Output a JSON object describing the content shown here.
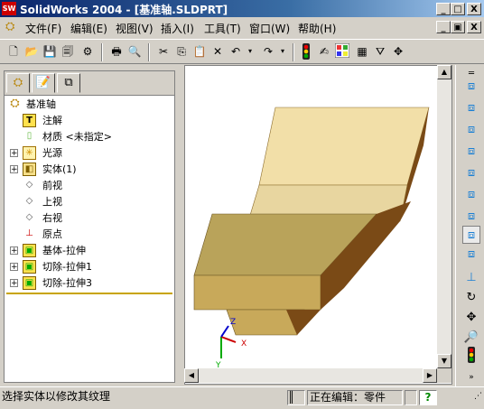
{
  "window": {
    "app_icon_label": "SW",
    "title": "SolidWorks 2004 - [基准轴.SLDPRT]",
    "controls": {
      "minimize": "_",
      "maximize": "□",
      "close": "X"
    },
    "doc_controls": {
      "minimize": "_",
      "restore": "▣",
      "close": "X"
    }
  },
  "menu": {
    "items": [
      "文件(F)",
      "编辑(E)",
      "视图(V)",
      "插入(I)",
      "工具(T)",
      "窗口(W)",
      "帮助(H)"
    ]
  },
  "toolbar": {
    "buttons": [
      "new",
      "open",
      "save",
      "print",
      "print-preview",
      "cut",
      "copy",
      "paste",
      "delete",
      "undo",
      "redo",
      "traffic-light",
      "select",
      "color",
      "grid",
      "filter",
      "pan"
    ]
  },
  "feature_tree": {
    "tabs": [
      "feature-manager",
      "property-manager",
      "configuration-manager"
    ],
    "root": "基准轴",
    "items": [
      {
        "label": "注解",
        "icon": "annotation-icon",
        "expander": ""
      },
      {
        "label": "材质 <未指定>",
        "icon": "material-icon",
        "expander": ""
      },
      {
        "label": "光源",
        "icon": "light-icon",
        "expander": "+"
      },
      {
        "label": "实体(1)",
        "icon": "solid-body-icon",
        "expander": "+"
      },
      {
        "label": "前视",
        "icon": "plane-icon",
        "expander": ""
      },
      {
        "label": "上视",
        "icon": "plane-icon",
        "expander": ""
      },
      {
        "label": "右视",
        "icon": "plane-icon",
        "expander": ""
      },
      {
        "label": "原点",
        "icon": "origin-icon",
        "expander": ""
      },
      {
        "label": "基体-拉伸",
        "icon": "extrude-icon",
        "expander": "+"
      },
      {
        "label": "切除-拉伸1",
        "icon": "cut-extrude-icon",
        "expander": "+"
      },
      {
        "label": "切除-拉伸3",
        "icon": "cut-extrude-icon",
        "expander": "+"
      }
    ]
  },
  "viewport": {
    "axis_labels": {
      "x": "X",
      "y": "Y",
      "z": "Z"
    }
  },
  "status": {
    "message": "选择实体以修改其纹理",
    "mode": "正在编辑：零件",
    "help_label": "?"
  },
  "colors": {
    "part_top": "#f2dfa8",
    "part_front": "#c8a95a",
    "part_dark": "#7a4a16",
    "title_start": "#0a246a"
  }
}
